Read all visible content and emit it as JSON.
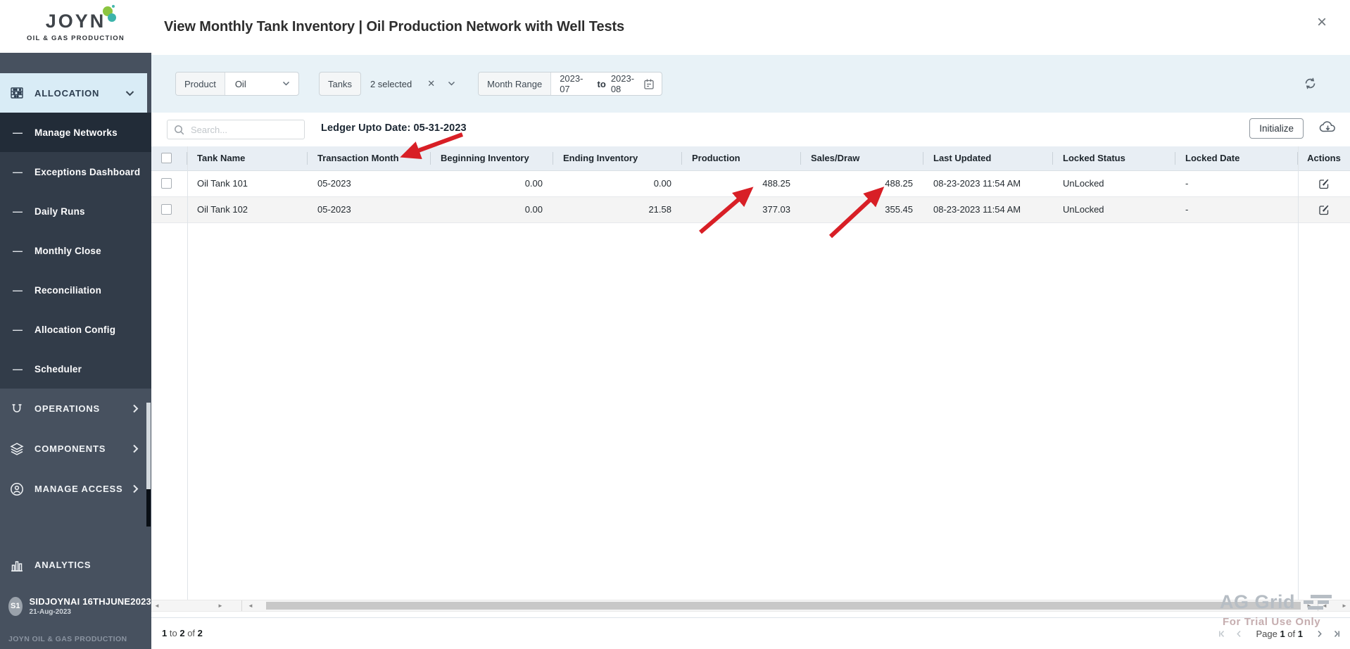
{
  "brand": {
    "name": "JOYN",
    "subtitle": "OIL & GAS PRODUCTION",
    "colors": {
      "logo_green": "#8bc540",
      "logo_teal": "#3cb4ab",
      "arrow_red": "#d81f26",
      "sidebar_bg": "#47515f",
      "allocation_highlight": "#d9ecf6",
      "filter_bar_bg": "#e8f2f7",
      "grid_header_bg": "#e8eef4"
    }
  },
  "sidebar": {
    "allocation": {
      "label": "ALLOCATION"
    },
    "submenu": [
      "Manage Networks",
      "Exceptions Dashboard",
      "Daily Runs",
      "Monthly Close",
      "Reconciliation",
      "Allocation Config",
      "Scheduler"
    ],
    "active_item": "Manage Networks",
    "sections": [
      {
        "label": "OPERATIONS"
      },
      {
        "label": "COMPONENTS"
      },
      {
        "label": "MANAGE ACCESS"
      }
    ],
    "analytics": {
      "label": "ANALYTICS"
    },
    "user": {
      "initials": "S1",
      "name": "SIDJOYNAI 16THJUNE2023",
      "date": "21-Aug-2023"
    },
    "footer": "JOYN OIL & GAS PRODUCTION"
  },
  "header": {
    "title": "View Monthly Tank Inventory | Oil Production Network with Well Tests",
    "close": "×"
  },
  "filters": {
    "product": {
      "label": "Product",
      "value": "Oil"
    },
    "tanks": {
      "label": "Tanks",
      "value": "2 selected",
      "clear": "✕"
    },
    "month_range": {
      "label": "Month Range",
      "from": "2023-07",
      "to_word": "to",
      "to": "2023-08"
    }
  },
  "toolbar": {
    "search_placeholder": "Search...",
    "ledger_label": "Ledger Upto Date: 05-31-2023",
    "initialize_label": "Initialize"
  },
  "table": {
    "columns": [
      "Tank Name",
      "Transaction Month",
      "Beginning Inventory",
      "Ending Inventory",
      "Production",
      "Sales/Draw",
      "Last Updated",
      "Locked Status",
      "Locked Date",
      "Actions"
    ],
    "rows": [
      {
        "tank_name": "Oil Tank 101",
        "transaction_month": "05-2023",
        "beginning_inventory": "0.00",
        "ending_inventory": "0.00",
        "production": "488.25",
        "sales_draw": "488.25",
        "last_updated": "08-23-2023 11:54 AM",
        "locked_status": "UnLocked",
        "locked_date": "-"
      },
      {
        "tank_name": "Oil Tank 102",
        "transaction_month": "05-2023",
        "beginning_inventory": "0.00",
        "ending_inventory": "21.58",
        "production": "377.03",
        "sales_draw": "355.45",
        "last_updated": "08-23-2023 11:54 AM",
        "locked_status": "UnLocked",
        "locked_date": "-"
      }
    ]
  },
  "status_bar": {
    "from": "1",
    "to_word": "to",
    "to": "2",
    "of_word": "of",
    "total": "2",
    "pagination": {
      "page_word": "Page",
      "current": "1",
      "of_word": "of",
      "total_pages": "1"
    }
  },
  "watermark": {
    "title": "AG Grid",
    "subtitle": "For Trial Use Only"
  }
}
